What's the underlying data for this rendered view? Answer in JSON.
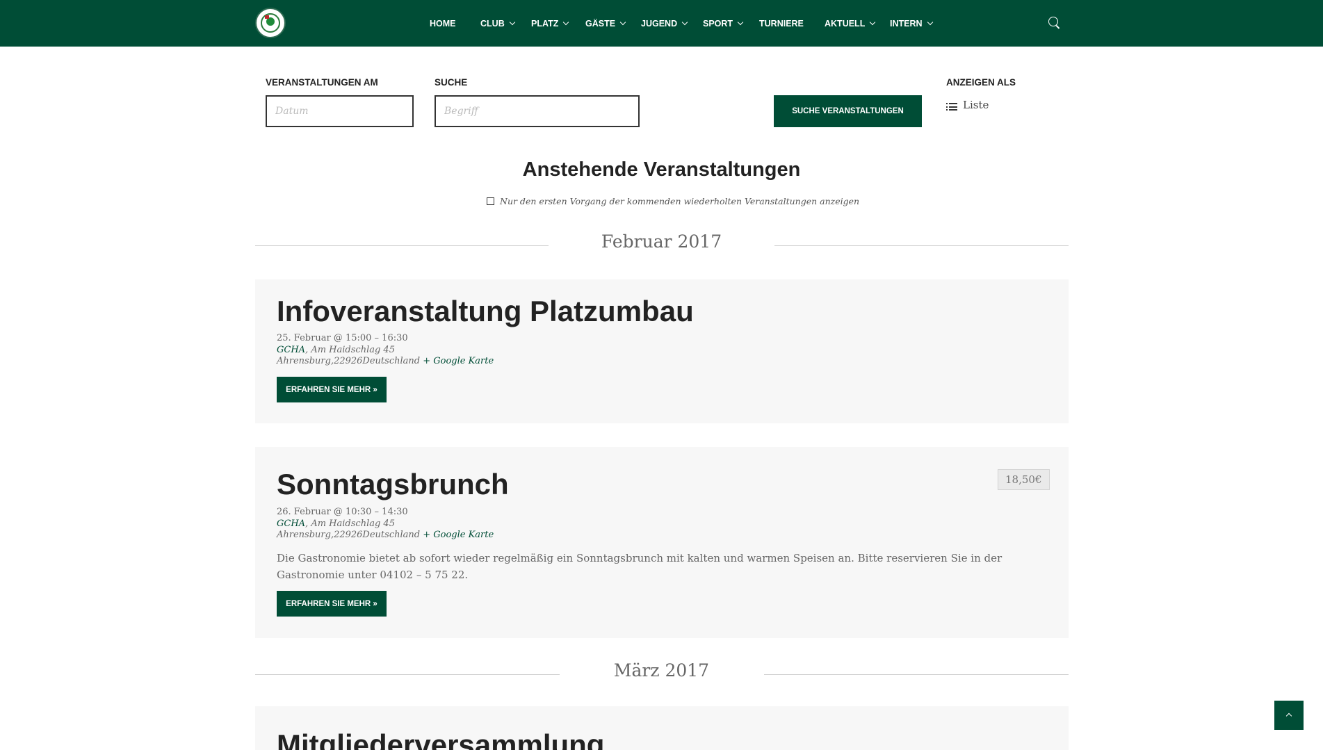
{
  "header": {
    "nav": [
      {
        "label": "HOME",
        "dropdown": false
      },
      {
        "label": "CLUB",
        "dropdown": true
      },
      {
        "label": "PLATZ",
        "dropdown": true
      },
      {
        "label": "GÄSTE",
        "dropdown": true
      },
      {
        "label": "JUGEND",
        "dropdown": true
      },
      {
        "label": "SPORT",
        "dropdown": true
      },
      {
        "label": "TURNIERE",
        "dropdown": false
      },
      {
        "label": "AKTUELL",
        "dropdown": true
      },
      {
        "label": "INTERN",
        "dropdown": true
      }
    ],
    "search_icon": "search-icon",
    "brand_color": "#004d36"
  },
  "filter": {
    "date_label": "VERANSTALTUNGEN AM",
    "date_placeholder": "Datum",
    "search_label": "SUCHE",
    "search_placeholder": "Begriff",
    "submit_label": "SUCHE VERANSTALTUNGEN",
    "view_label": "ANZEIGEN ALS",
    "view_value": "Liste"
  },
  "main": {
    "title": "Anstehende Veranstaltungen",
    "recurring_option": "Nur den ersten Vorgang der kommenden wiederholten Veranstaltungen anzeigen"
  },
  "months": [
    {
      "label": "Februar 2017",
      "events": [
        {
          "title": "Infoveranstaltung Platzumbau",
          "datetime": "25. Februar @ 15:00 – 16:30",
          "venue_name": "GCHA",
          "venue_address": ", Am Haidschlag 45",
          "city_line": "Ahrensburg,22926Deutschland",
          "map_link": "+ Google Karte",
          "more_label": "ERFAHREN SIE MEHR »"
        },
        {
          "title": "Sonntagsbrunch",
          "price": "18,50€",
          "datetime": "26. Februar @ 10:30 – 14:30",
          "venue_name": "GCHA",
          "venue_address": ", Am Haidschlag 45",
          "city_line": "Ahrensburg,22926Deutschland",
          "map_link": "+ Google Karte",
          "description": "Die Gastronomie bietet ab sofort wieder regelmäßig ein Sonntagsbrunch mit kalten und warmen Speisen an. Bitte reservieren Sie in der Gastronomie unter 04102 – 5 75 22.",
          "more_label": "ERFAHREN SIE MEHR »"
        }
      ]
    },
    {
      "label": "März 2017",
      "events": [
        {
          "title": "Mitgliederversammlung"
        }
      ]
    }
  ]
}
